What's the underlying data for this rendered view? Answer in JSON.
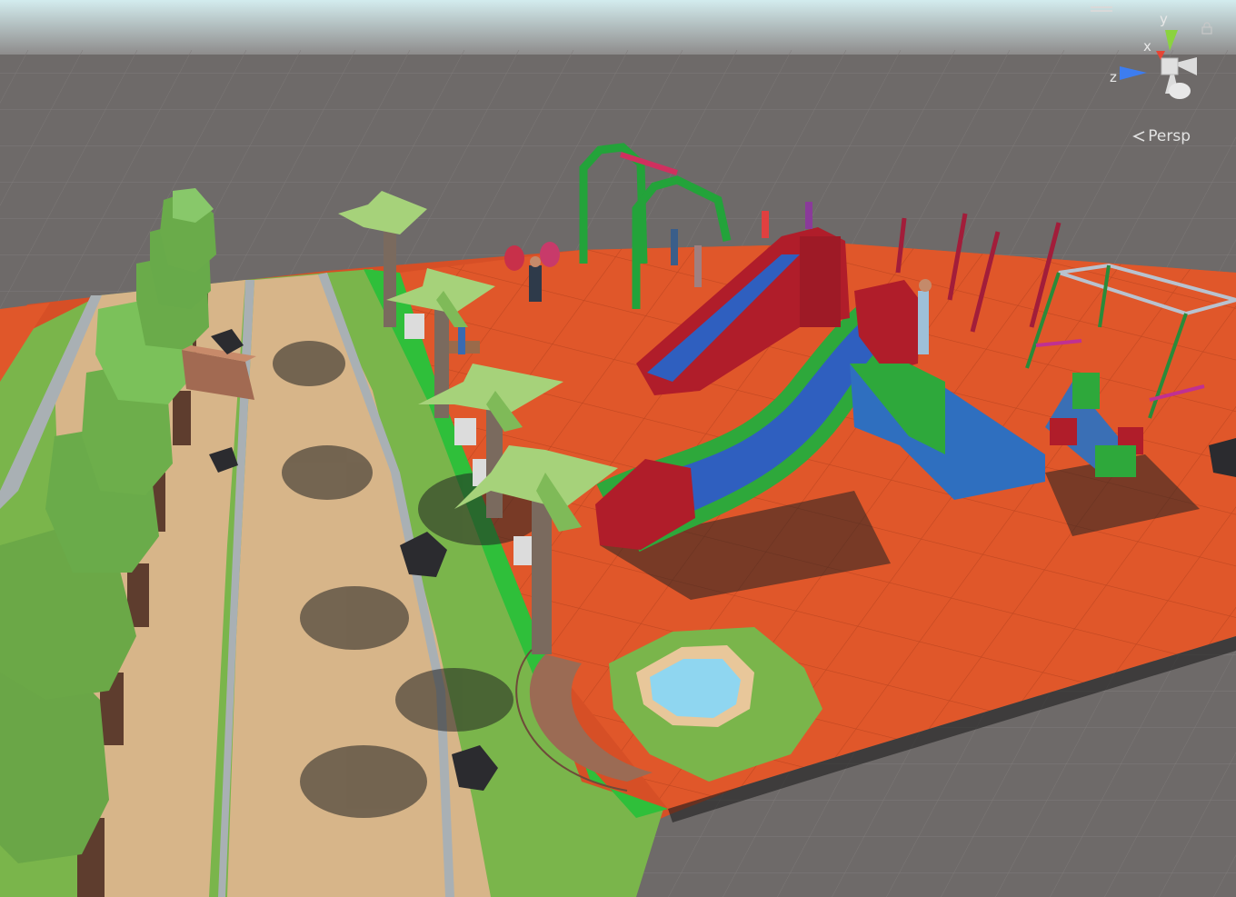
{
  "viewport": {
    "camera_mode_label": "Persp",
    "camera_mode_icon": "chevron-left-icon"
  },
  "gizmo": {
    "x_label": "x",
    "y_label": "y",
    "z_label": "z",
    "x_color": "#e64535",
    "y_color": "#8bd33f",
    "z_color": "#3d7df0"
  },
  "colors": {
    "ground": "#e0572a",
    "grass": "#7ab54b",
    "path": "#d7b589",
    "background_grid": "#6e6a69",
    "sky": "#d6ecef"
  }
}
